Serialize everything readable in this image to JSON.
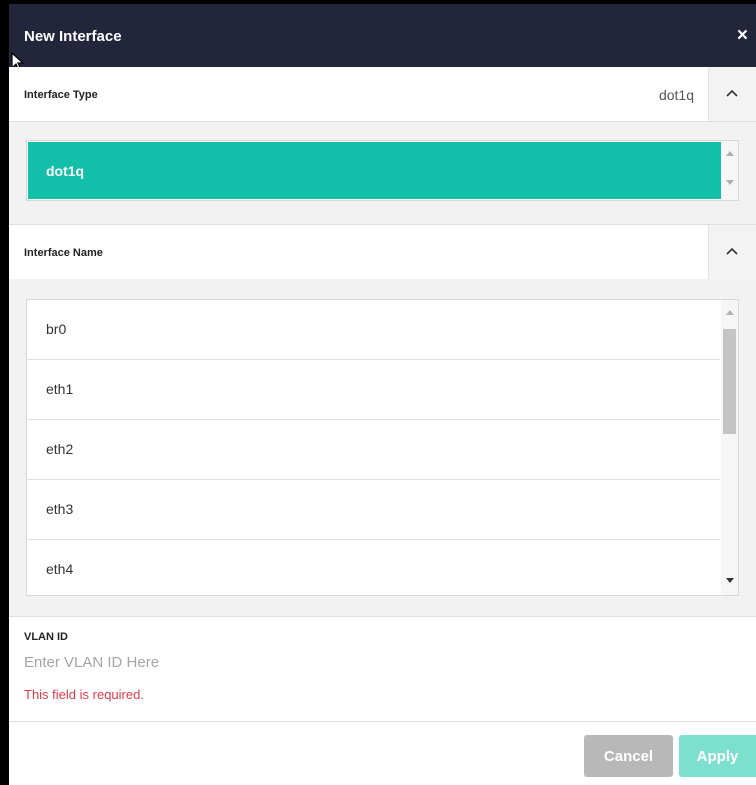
{
  "dialog": {
    "title": "New Interface",
    "close_glyph": "×"
  },
  "interface_type": {
    "label": "Interface Type",
    "value": "dot1q",
    "options": [
      "dot1q"
    ],
    "selected": "dot1q"
  },
  "interface_name": {
    "label": "Interface Name",
    "options": [
      "br0",
      "eth1",
      "eth2",
      "eth3",
      "eth4"
    ]
  },
  "vlan": {
    "label": "VLAN ID",
    "placeholder": "Enter VLAN ID Here",
    "value": "",
    "error": "This field is required."
  },
  "buttons": {
    "cancel": "Cancel",
    "apply": "Apply"
  },
  "colors": {
    "titlebar": "#23263a",
    "accent": "#12bfa8",
    "error": "#e3394a"
  },
  "icons": [
    "close-icon",
    "chevron-up-icon",
    "arrow-up-icon",
    "arrow-down-icon",
    "mouse-cursor-icon"
  ]
}
